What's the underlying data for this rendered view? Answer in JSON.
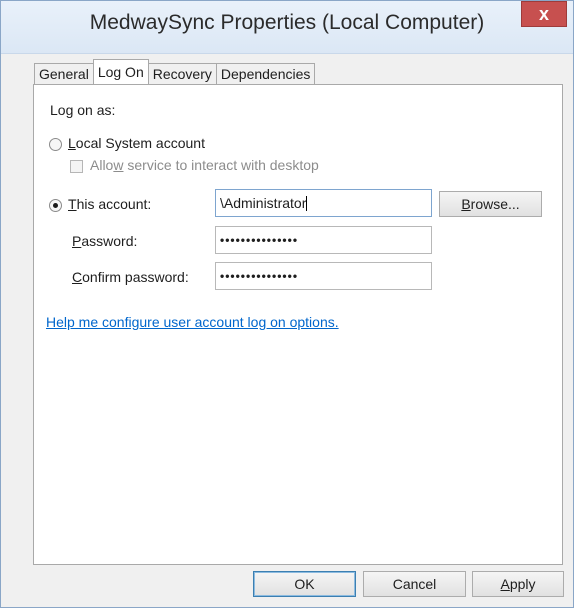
{
  "window": {
    "title": "MedwaySync Properties (Local Computer)",
    "close_glyph": "x"
  },
  "tabs": [
    {
      "label": "General",
      "active": false
    },
    {
      "label": "Log On",
      "active": true
    },
    {
      "label": "Recovery",
      "active": false
    },
    {
      "label": "Dependencies",
      "active": false
    }
  ],
  "logon": {
    "heading": "Log on as:",
    "local_system": {
      "label_accel": "L",
      "label_rest": "ocal System account",
      "selected": false
    },
    "interact_desktop": {
      "label_pre": "Allo",
      "label_accel": "w",
      "label_post": " service to interact with desktop",
      "checked": false,
      "enabled": false
    },
    "this_account": {
      "label_accel": "T",
      "label_rest": "his account:",
      "selected": true,
      "value": "\\Administrator"
    },
    "password": {
      "label_accel": "P",
      "label_rest": "assword:",
      "value": "•••••••••••••••"
    },
    "confirm_password": {
      "label_accel": "C",
      "label_rest": "onfirm password:",
      "value": "•••••••••••••••"
    },
    "browse_button": {
      "label_accel": "B",
      "label_rest": "rowse..."
    },
    "help_link": "Help me configure user account log on options."
  },
  "buttons": {
    "ok": "OK",
    "cancel": "Cancel",
    "apply_accel": "A",
    "apply_rest": "pply"
  },
  "colors": {
    "link": "#0066cc",
    "title_bar": "#dbe7f5",
    "close_button": "#c7504f"
  }
}
